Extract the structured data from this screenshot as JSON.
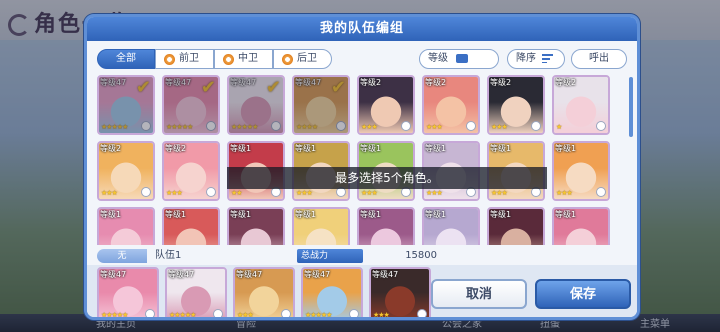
{
  "background": {
    "screen_title": "角色一览",
    "nav": [
      "我的主页",
      "冒险",
      "公会之家",
      "扭蛋",
      "主菜单"
    ]
  },
  "panel": {
    "title": "我的队伍编组",
    "tabs": [
      {
        "label": "全部",
        "active": true
      },
      {
        "label": "前卫",
        "active": false
      },
      {
        "label": "中卫",
        "active": false
      },
      {
        "label": "后卫",
        "active": false
      }
    ],
    "sort_level_label": "等级",
    "sort_order_label": "降序",
    "call_label": "呼出"
  },
  "roster": [
    {
      "level": "等级47",
      "stars": "★★★★★",
      "selected": true,
      "colors": [
        "#e9a2c7",
        "#a3cbe8"
      ]
    },
    {
      "level": "等级47",
      "stars": "★★★★★",
      "selected": true,
      "colors": [
        "#e98aab",
        "#f5c6d9"
      ]
    },
    {
      "level": "等级47",
      "stars": "★★★★★",
      "selected": true,
      "colors": [
        "#efe7ee",
        "#d99ab4"
      ]
    },
    {
      "level": "等级47",
      "stars": "★★★★",
      "selected": true,
      "colors": [
        "#d79a52",
        "#f2d49b"
      ]
    },
    {
      "level": "等级2",
      "stars": "★★★",
      "selected": false,
      "colors": [
        "#3d3045",
        "#efc9b3"
      ]
    },
    {
      "level": "等级2",
      "stars": "★★★",
      "selected": false,
      "colors": [
        "#e8877e",
        "#f4c2a5"
      ]
    },
    {
      "level": "等级2",
      "stars": "★★★",
      "selected": false,
      "colors": [
        "#2a2a34",
        "#f0d2bf"
      ]
    },
    {
      "level": "等级2",
      "stars": "★",
      "selected": false,
      "colors": [
        "#e8e2ea",
        "#f4cfd8"
      ]
    },
    {
      "level": "等级2",
      "stars": "★★★",
      "selected": false,
      "colors": [
        "#f0b25e",
        "#f6d9b8"
      ]
    },
    {
      "level": "等级2",
      "stars": "★★★",
      "selected": false,
      "colors": [
        "#f19aa8",
        "#f6d3cf"
      ]
    },
    {
      "level": "等级1",
      "stars": "★★",
      "selected": false,
      "colors": [
        "#c33c4a",
        "#f1c7b8"
      ]
    },
    {
      "level": "等级1",
      "stars": "★★★",
      "selected": false,
      "colors": [
        "#c6a24a",
        "#f2d7c0"
      ]
    },
    {
      "level": "等级1",
      "stars": "★★★",
      "selected": false,
      "colors": [
        "#9ac45d",
        "#eedcc3"
      ]
    },
    {
      "level": "等级1",
      "stars": "★★★",
      "selected": false,
      "colors": [
        "#c7b6d3",
        "#efe1ea"
      ]
    },
    {
      "level": "等级1",
      "stars": "★★★",
      "selected": false,
      "colors": [
        "#e7b96a",
        "#f3d8c0"
      ]
    },
    {
      "level": "等级1",
      "stars": "★★★",
      "selected": false,
      "colors": [
        "#f0a052",
        "#f6dbc2"
      ]
    },
    {
      "level": "等级1",
      "stars": "",
      "selected": false,
      "colors": [
        "#e68cb0",
        "#f4cbd8"
      ]
    },
    {
      "level": "等级1",
      "stars": "",
      "selected": false,
      "colors": [
        "#d85a5a",
        "#f2c4b6"
      ]
    },
    {
      "level": "等级1",
      "stars": "",
      "selected": false,
      "colors": [
        "#7a3f56",
        "#e8c8d4"
      ]
    },
    {
      "level": "等级1",
      "stars": "",
      "selected": false,
      "colors": [
        "#f0d07a",
        "#f6e2c4"
      ]
    },
    {
      "level": "等级1",
      "stars": "",
      "selected": false,
      "colors": [
        "#9c5a8a",
        "#ecc8de"
      ]
    },
    {
      "level": "等级1",
      "stars": "",
      "selected": false,
      "colors": [
        "#b6a8d0",
        "#ece2f2"
      ]
    },
    {
      "level": "等级1",
      "stars": "",
      "selected": false,
      "colors": [
        "#5a2a3a",
        "#d9b0a0"
      ]
    },
    {
      "level": "等级1",
      "stars": "",
      "selected": false,
      "colors": [
        "#e07a9a",
        "#f4cfd8"
      ]
    }
  ],
  "toast": "最多选择5个角色。",
  "team": {
    "tag": "无",
    "name": "队伍1",
    "power_label": "总战力",
    "power_value": "15800",
    "members": [
      {
        "level": "等级47",
        "stars": "★★★★★",
        "colors": [
          "#e98aab",
          "#f5c6d9"
        ]
      },
      {
        "level": "等级47",
        "stars": "★★★★★",
        "colors": [
          "#efe7ee",
          "#d99ab4"
        ]
      },
      {
        "level": "等级47",
        "stars": "★★★",
        "colors": [
          "#d79a52",
          "#f2d49b"
        ]
      },
      {
        "level": "等级47",
        "stars": "★★★★★",
        "colors": [
          "#e9a24a",
          "#a3cbe8"
        ]
      },
      {
        "level": "等级47",
        "stars": "★★★",
        "colors": [
          "#3a2a2a",
          "#8a3a2a"
        ]
      }
    ]
  },
  "buttons": {
    "cancel": "取消",
    "save": "保存"
  },
  "colors": {
    "accent": "#2f63b8",
    "frame": "#5f8fd6",
    "star": "#f6c531"
  }
}
